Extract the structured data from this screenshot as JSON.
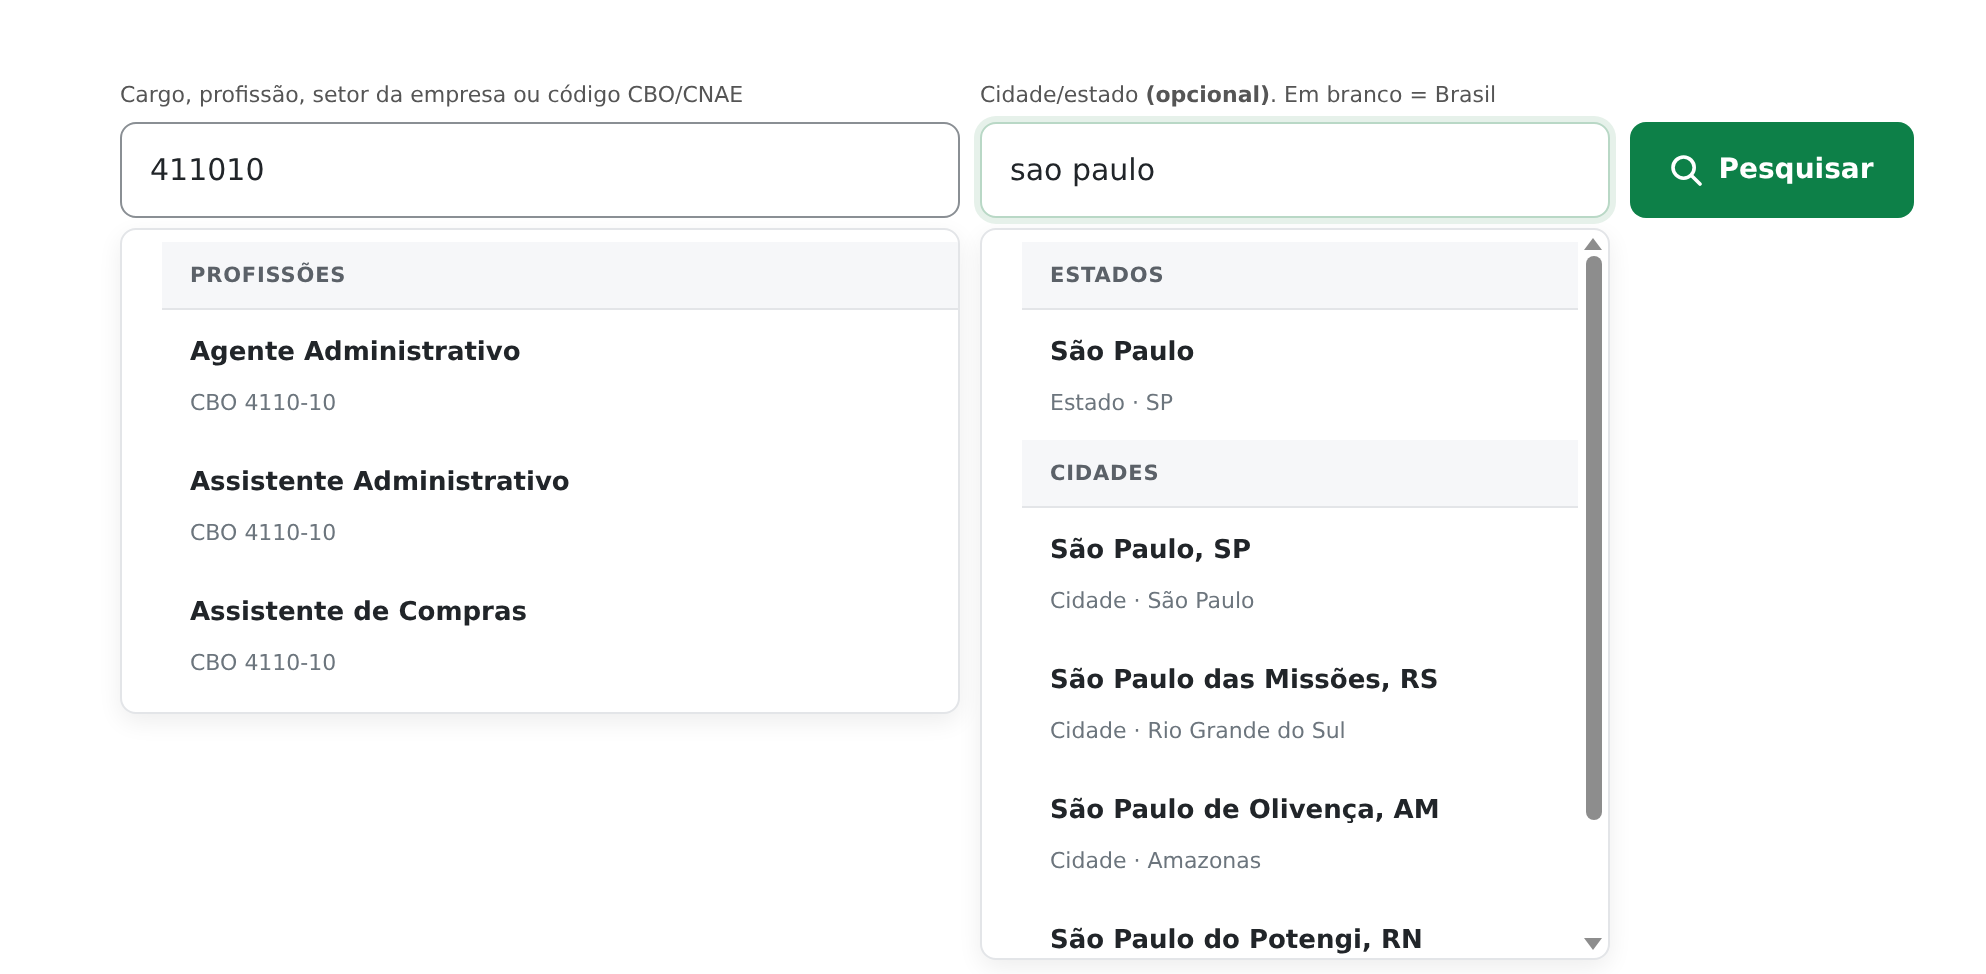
{
  "occupation": {
    "label": "Cargo, profissão, setor da empresa ou código CBO/CNAE",
    "value": "411010",
    "focused": false,
    "dropdown": [
      {
        "kind": "header",
        "text": "PROFISSÕES"
      },
      {
        "kind": "option",
        "title": "Agente Administrativo",
        "subtitle": "CBO 4110-10"
      },
      {
        "kind": "option",
        "title": "Assistente Administrativo",
        "subtitle": "CBO 4110-10"
      },
      {
        "kind": "option",
        "title": "Assistente de Compras",
        "subtitle": "CBO 4110-10"
      }
    ]
  },
  "location": {
    "label": "Cidade/estado **(opcional)**. Em branco = Brasil",
    "value": "sao paulo",
    "focused": true,
    "dropdown": [
      {
        "kind": "header",
        "text": "ESTADOS"
      },
      {
        "kind": "option",
        "title": "São Paulo",
        "subtitle": "Estado · SP"
      },
      {
        "kind": "header",
        "text": "CIDADES"
      },
      {
        "kind": "option",
        "title": "São Paulo, SP",
        "subtitle": "Cidade · São Paulo"
      },
      {
        "kind": "option",
        "title": "São Paulo das Missões, RS",
        "subtitle": "Cidade · Rio Grande do Sul"
      },
      {
        "kind": "option",
        "title": "São Paulo de Olivença, AM",
        "subtitle": "Cidade · Amazonas"
      },
      {
        "kind": "option",
        "title": "São Paulo do Potengi, RN"
      }
    ]
  },
  "search_button": {
    "label": "Pesquisar"
  }
}
